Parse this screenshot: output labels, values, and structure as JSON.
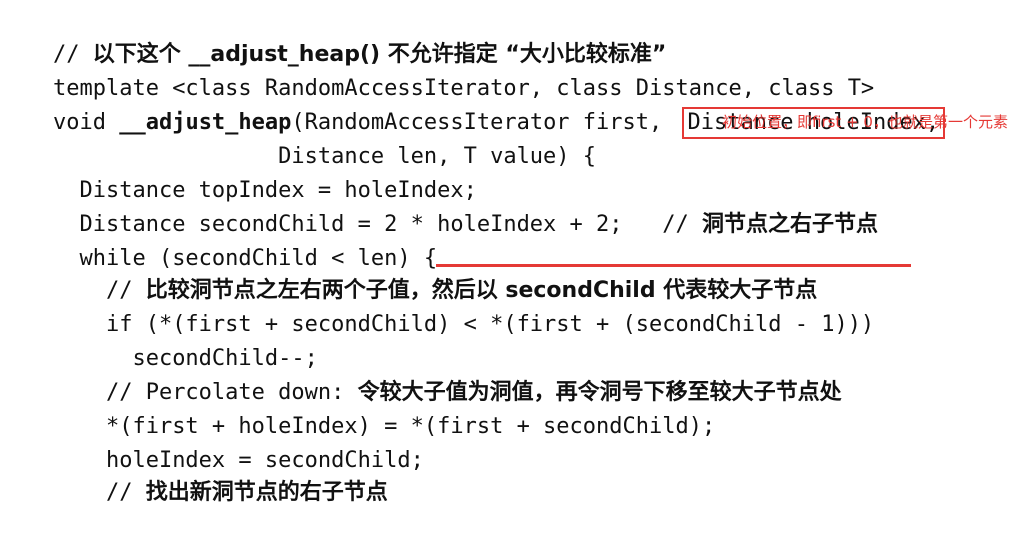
{
  "code_lines": [
    {
      "comment_prefix": "// ",
      "comment_text": "以下这个 __adjust_heap() 不允许指定 “大小比较标准”"
    },
    {
      "text": "template <class RandomAccessIterator, class Distance, class T>"
    },
    {
      "prefix": "void ",
      "bold_name": "__adjust_heap",
      "middle": "(RandomAccessIterator first, ",
      "boxed_param": "Distance holeIndex,"
    },
    {
      "text": "                 Distance len, T value) {"
    },
    {
      "text": "  Distance topIndex = holeIndex;"
    },
    {
      "code": "  Distance secondChild = 2 * holeIndex + 2;",
      "comment_prefix": "   // ",
      "comment_text": "洞节点之右子节点"
    },
    {
      "text": "  while (secondChild < len) {"
    },
    {
      "comment_prefix": "    // ",
      "comment_text": "比较洞节点之左右两个子值，然后以 secondChild 代表较大子节点"
    },
    {
      "text": "    if (*(first + secondChild) < *(first + (secondChild - 1)))"
    },
    {
      "text": "      secondChild--;"
    },
    {
      "comment_prefix": "    // Percolate down: ",
      "comment_text": "令较大子值为洞值，再令洞号下移至较大子节点处"
    },
    {
      "text": "    *(first + holeIndex) = *(first + secondChild);"
    },
    {
      "text": "    holeIndex = secondChild;"
    },
    {
      "comment_prefix": "    // ",
      "comment_text": "找出新洞节点的右子节点"
    }
  ],
  "annotation": {
    "text": "初始位置，即first + 0，也就是第一个元素",
    "color": "#e53935"
  },
  "highlight": {
    "box_color": "#e53935",
    "underline_color": "#e53935"
  }
}
